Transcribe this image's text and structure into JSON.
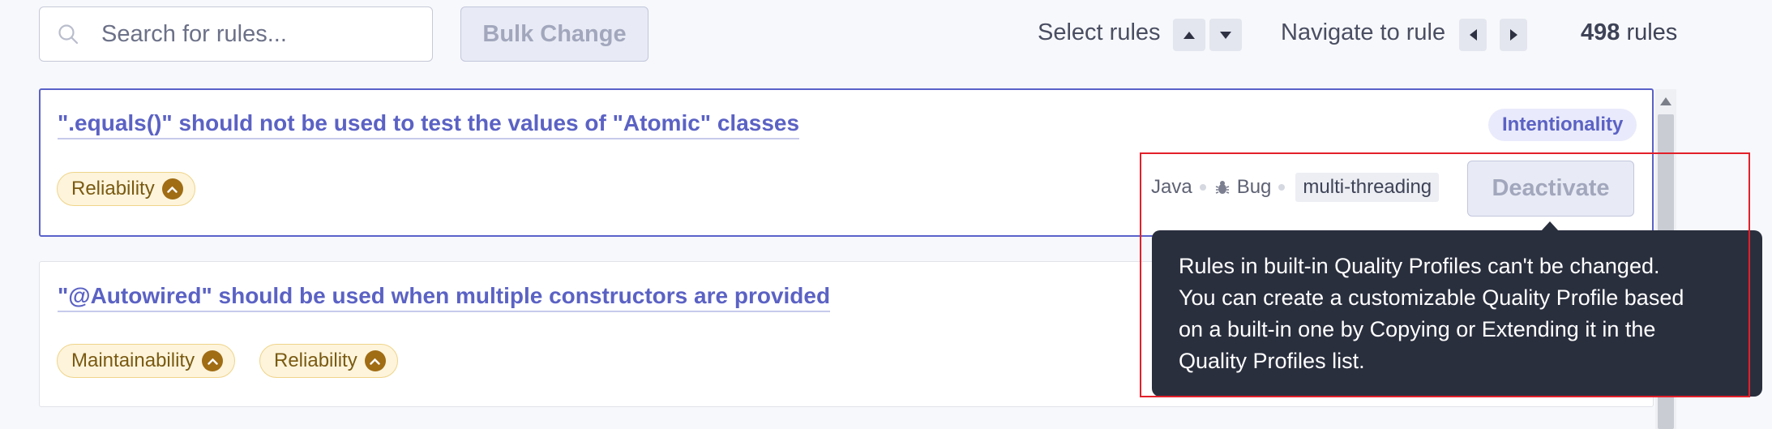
{
  "toolbar": {
    "search_placeholder": "Search for rules...",
    "bulk_change_label": "Bulk Change",
    "select_rules_label": "Select rules",
    "navigate_label": "Navigate to rule",
    "rule_count": "498",
    "rule_count_suffix": " rules"
  },
  "rules": [
    {
      "title": "\".equals()\" should not be used to test the values of \"Atomic\" classes",
      "tags": [
        "Reliability"
      ],
      "category_badge": "Intentionality",
      "language": "Java",
      "type": "Bug",
      "rule_tag": "multi-threading",
      "action_label": "Deactivate"
    },
    {
      "title": "\"@Autowired\" should be used when multiple constructors are provided",
      "tags": [
        "Maintainability",
        "Reliability"
      ]
    }
  ],
  "tooltip": {
    "lines": [
      "Rules in built-in Quality Profiles can't be changed.",
      "You can create a customizable Quality Profile based",
      "on a built-in one by Copying or Extending it in the",
      "Quality Profiles list."
    ]
  },
  "colors": {
    "accent": "#5b62c4",
    "tooltip_bg": "#2a2f3e",
    "tag_bg": "#fdf4db",
    "highlight": "#e3202a"
  }
}
